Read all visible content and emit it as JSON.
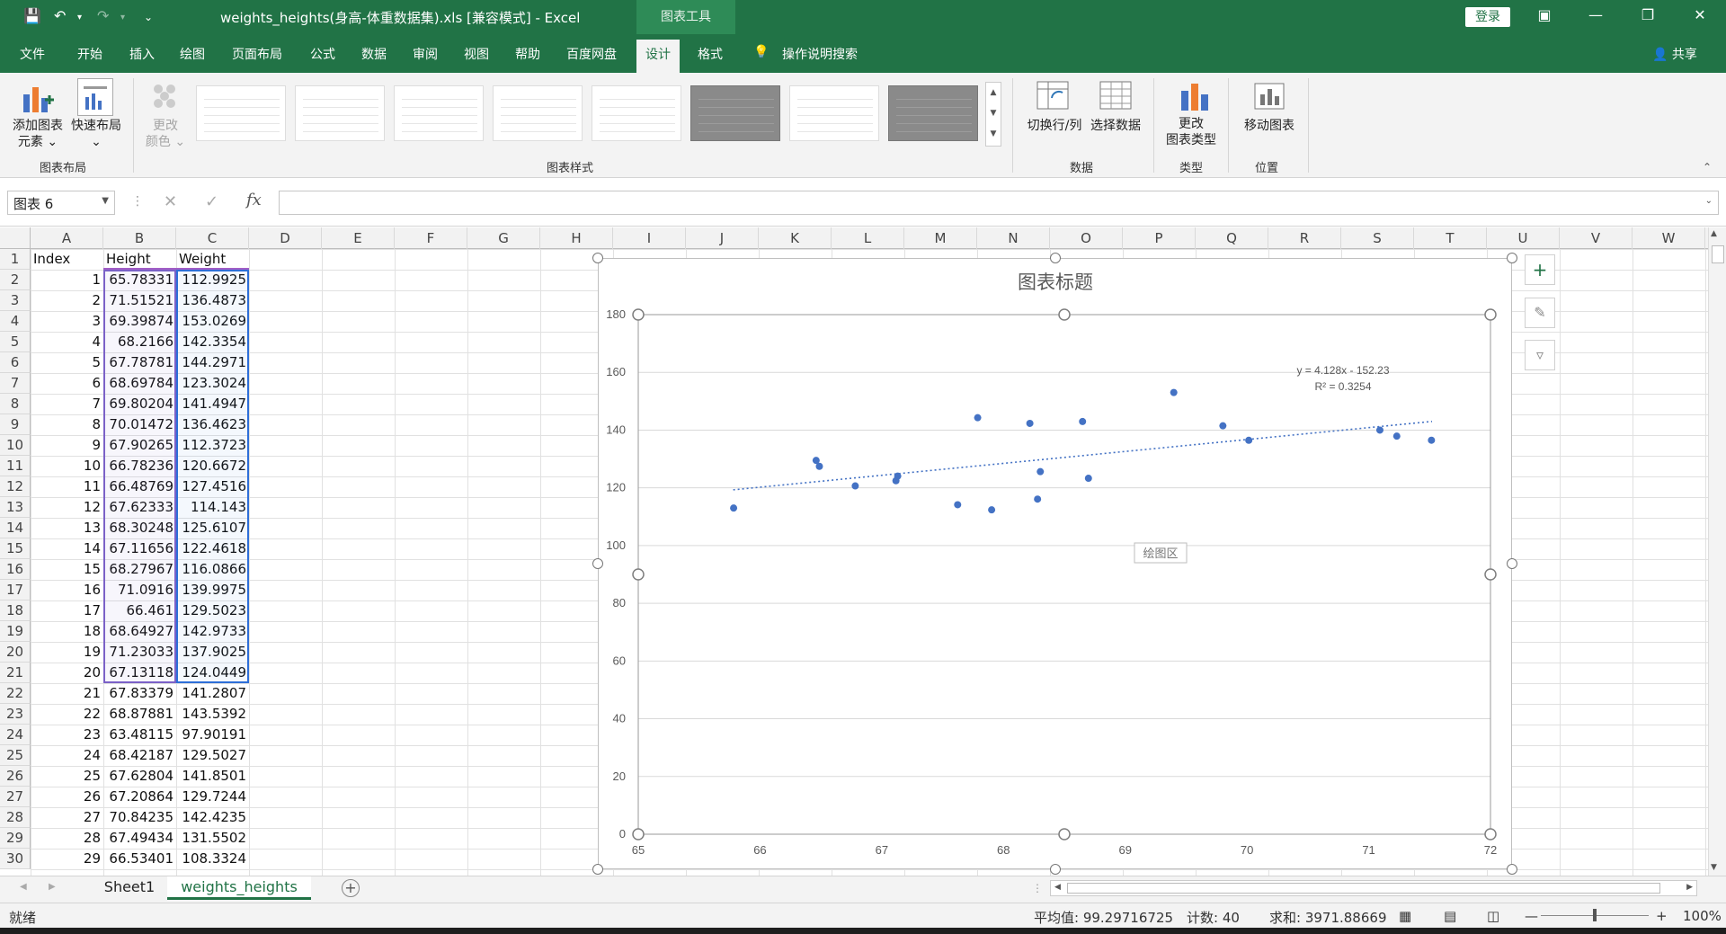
{
  "titlebar": {
    "title": "weights_heights(身高-体重数据集).xls  [兼容模式]  -  Excel",
    "chart_tools": "图表工具",
    "login": "登录"
  },
  "tabs": [
    "文件",
    "开始",
    "插入",
    "绘图",
    "页面布局",
    "公式",
    "数据",
    "审阅",
    "视图",
    "帮助",
    "百度网盘",
    "设计",
    "格式"
  ],
  "active_tab": "设计",
  "tell_me": "操作说明搜索",
  "share": "共享",
  "ribbon": {
    "add_element": [
      "添加图表",
      "元素"
    ],
    "quick_layout": "快速布局",
    "change_colors": [
      "更改",
      "颜色"
    ],
    "group_layout": "图表布局",
    "group_styles": "图表样式",
    "switch_rowcol": "切换行/列",
    "select_data": "选择数据",
    "group_data": "数据",
    "change_type": [
      "更改",
      "图表类型"
    ],
    "group_type": "类型",
    "move_chart": "移动图表",
    "group_location": "位置"
  },
  "formula": {
    "namebox": "图表 6",
    "fx": "fx"
  },
  "columns": [
    "A",
    "B",
    "C",
    "D",
    "E",
    "F",
    "G",
    "H",
    "I",
    "J",
    "K",
    "L",
    "M",
    "N",
    "O",
    "P",
    "Q",
    "R",
    "S",
    "T",
    "U",
    "V",
    "W"
  ],
  "headers": [
    "Index",
    "Height",
    "Weight"
  ],
  "rows": [
    [
      "1",
      "65.78331",
      "112.9925"
    ],
    [
      "2",
      "71.51521",
      "136.4873"
    ],
    [
      "3",
      "69.39874",
      "153.0269"
    ],
    [
      "4",
      "68.2166",
      "142.3354"
    ],
    [
      "5",
      "67.78781",
      "144.2971"
    ],
    [
      "6",
      "68.69784",
      "123.3024"
    ],
    [
      "7",
      "69.80204",
      "141.4947"
    ],
    [
      "8",
      "70.01472",
      "136.4623"
    ],
    [
      "9",
      "67.90265",
      "112.3723"
    ],
    [
      "10",
      "66.78236",
      "120.6672"
    ],
    [
      "11",
      "66.48769",
      "127.4516"
    ],
    [
      "12",
      "67.62333",
      "114.143"
    ],
    [
      "13",
      "68.30248",
      "125.6107"
    ],
    [
      "14",
      "67.11656",
      "122.4618"
    ],
    [
      "15",
      "68.27967",
      "116.0866"
    ],
    [
      "16",
      "71.0916",
      "139.9975"
    ],
    [
      "17",
      "66.461",
      "129.5023"
    ],
    [
      "18",
      "68.64927",
      "142.9733"
    ],
    [
      "19",
      "71.23033",
      "137.9025"
    ],
    [
      "20",
      "67.13118",
      "124.0449"
    ],
    [
      "21",
      "67.83379",
      "141.2807"
    ],
    [
      "22",
      "68.87881",
      "143.5392"
    ],
    [
      "23",
      "63.48115",
      "97.90191"
    ],
    [
      "24",
      "68.42187",
      "129.5027"
    ],
    [
      "25",
      "67.62804",
      "141.8501"
    ],
    [
      "26",
      "67.20864",
      "129.7244"
    ],
    [
      "27",
      "70.84235",
      "142.4235"
    ],
    [
      "28",
      "67.49434",
      "131.5502"
    ],
    [
      "29",
      "66.53401",
      "108.3324"
    ]
  ],
  "row_numbers": [
    "1",
    "2",
    "3",
    "4",
    "5",
    "6",
    "7",
    "8",
    "9",
    "10",
    "11",
    "12",
    "13",
    "14",
    "15",
    "16",
    "17",
    "18",
    "19",
    "20",
    "21",
    "22",
    "23",
    "24",
    "25",
    "26",
    "27",
    "28",
    "29",
    "30"
  ],
  "chart_data": {
    "type": "scatter",
    "title": "图表标题",
    "xlim": [
      65,
      72
    ],
    "ylim": [
      0,
      180
    ],
    "xticks": [
      "65",
      "66",
      "67",
      "68",
      "69",
      "70",
      "71",
      "72"
    ],
    "yticks": [
      "0",
      "20",
      "40",
      "60",
      "80",
      "100",
      "120",
      "140",
      "160",
      "180"
    ],
    "points": [
      [
        65.78331,
        112.9925
      ],
      [
        71.51521,
        136.4873
      ],
      [
        69.39874,
        153.0269
      ],
      [
        68.2166,
        142.3354
      ],
      [
        67.78781,
        144.2971
      ],
      [
        68.69784,
        123.3024
      ],
      [
        69.80204,
        141.4947
      ],
      [
        70.01472,
        136.4623
      ],
      [
        67.90265,
        112.3723
      ],
      [
        66.78236,
        120.6672
      ],
      [
        66.48769,
        127.4516
      ],
      [
        67.62333,
        114.143
      ],
      [
        68.30248,
        125.6107
      ],
      [
        67.11656,
        122.4618
      ],
      [
        68.27967,
        116.0866
      ],
      [
        71.0916,
        139.9975
      ],
      [
        66.461,
        129.5023
      ],
      [
        68.64927,
        142.9733
      ],
      [
        71.23033,
        137.9025
      ],
      [
        67.13118,
        124.0449
      ]
    ],
    "series_color": "#4472c4",
    "trendline": {
      "slope": 4.128,
      "intercept": -152.23,
      "x_from": 65.78,
      "x_to": 71.52
    },
    "equation": "y = 4.128x - 152.23",
    "r2": "R² = 0.3254",
    "plot_area_tooltip": "绘图区",
    "grid": true
  },
  "sheets": [
    "Sheet1",
    "weights_heights"
  ],
  "active_sheet": "weights_heights",
  "status": {
    "ready": "就绪",
    "average": "平均值: 99.29716725",
    "count": "计数: 40",
    "sum": "求和: 3971.88669",
    "zoom": "100%"
  }
}
